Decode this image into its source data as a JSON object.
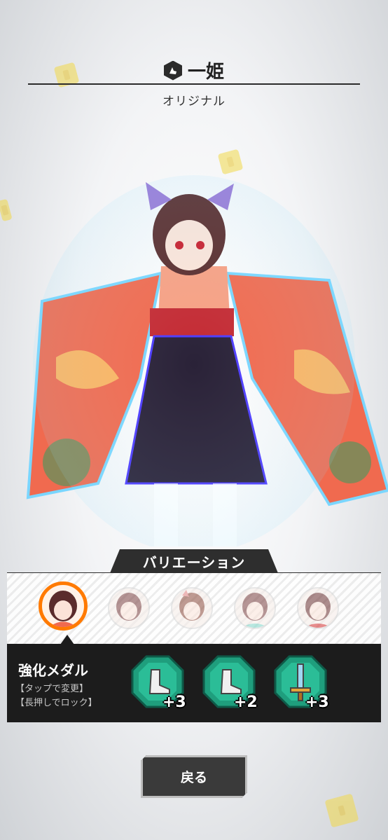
{
  "header": {
    "character_name": "一姫",
    "subtitle": "オリジナル",
    "icon": "cat-paw-icon"
  },
  "variation": {
    "title": "バリエーション",
    "selected_index": 0,
    "items": [
      {
        "name": "original",
        "state": "selected"
      },
      {
        "name": "variant-2",
        "state": "dim"
      },
      {
        "name": "variant-3",
        "state": "dim"
      },
      {
        "name": "variant-4",
        "state": "dim"
      },
      {
        "name": "variant-5",
        "state": "dim"
      }
    ]
  },
  "medals": {
    "title": "強化メダル",
    "hint_tap": "【タップで変更】",
    "hint_hold": "【長押しでロック】",
    "items": [
      {
        "icon": "boot-icon",
        "level": "+3"
      },
      {
        "icon": "boot-icon",
        "level": "+2"
      },
      {
        "icon": "sword-icon",
        "level": "+3"
      }
    ]
  },
  "buttons": {
    "back_label": "戻る"
  },
  "colors": {
    "accent_orange": "#ff7a00",
    "panel_dark": "#1c1c1c",
    "medal_green": "#1f9e7d"
  }
}
